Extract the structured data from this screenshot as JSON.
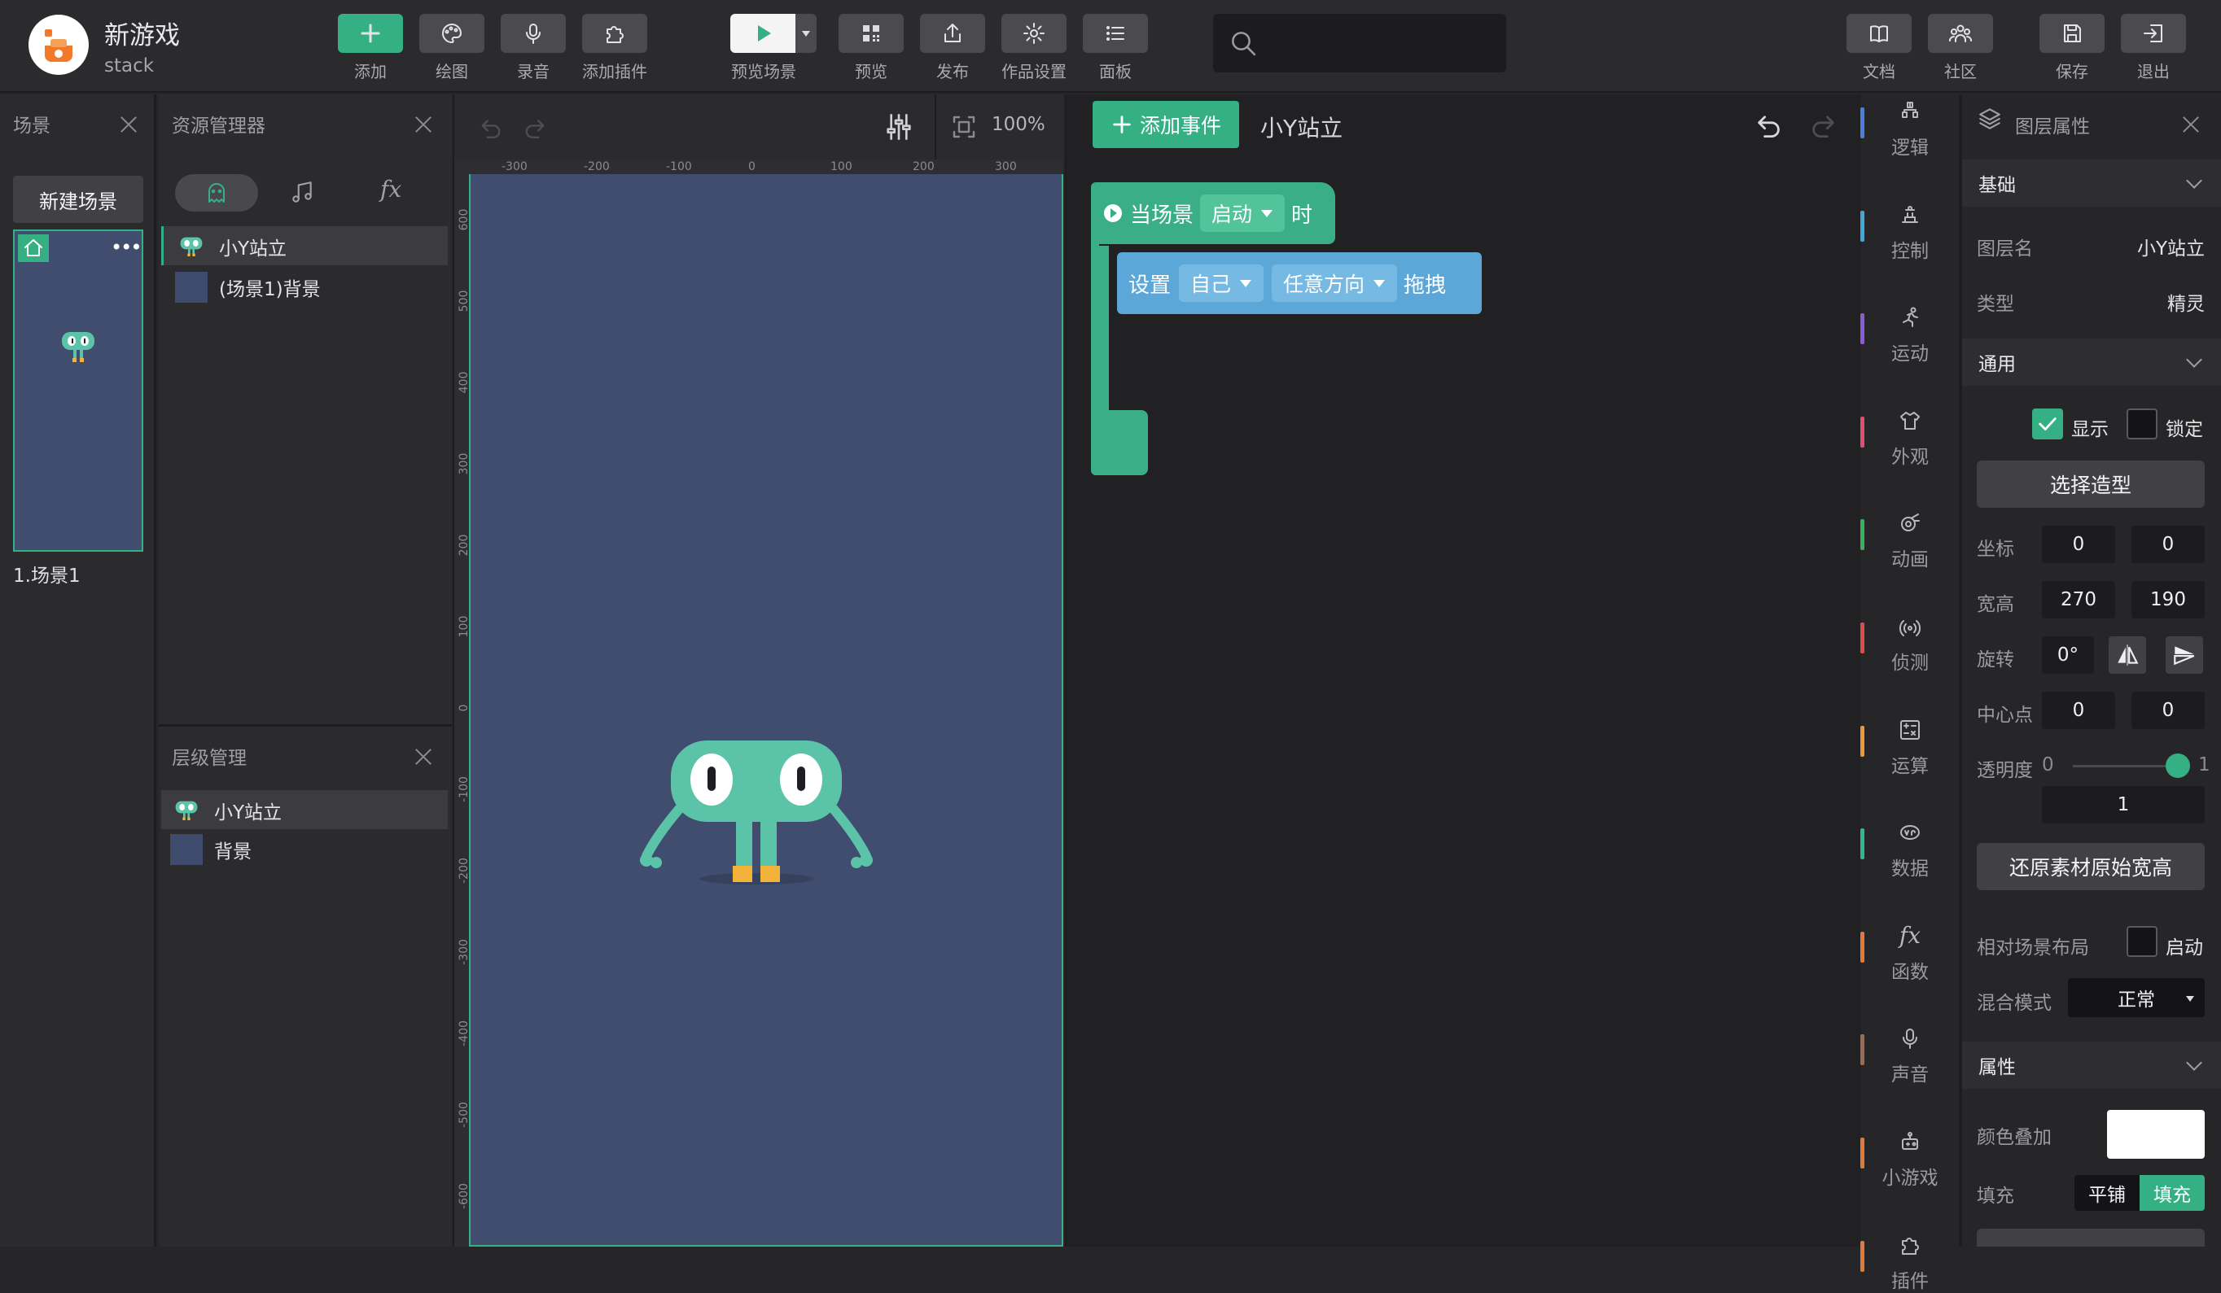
{
  "app": {
    "title": "新游戏",
    "user": "stack"
  },
  "toolbar": {
    "add": "添加",
    "paint": "绘图",
    "record": "录音",
    "plugin": "添加插件",
    "preview_scene": "预览场景",
    "preview": "预览",
    "publish": "发布",
    "settings": "作品设置",
    "panel": "面板",
    "docs": "文档",
    "community": "社区",
    "save": "保存",
    "exit": "退出"
  },
  "scenes_panel": {
    "title": "场景",
    "new_scene": "新建场景",
    "scene_label": "1.场景1",
    "more": "•••"
  },
  "assets_panel": {
    "title": "资源管理器",
    "fx_tab": "fx",
    "items": [
      {
        "label": "小Y站立"
      },
      {
        "label": "(场景1)背景"
      }
    ]
  },
  "layers_panel": {
    "title": "层级管理",
    "items": [
      {
        "label": "小Y站立"
      },
      {
        "label": "背景"
      }
    ]
  },
  "canvas": {
    "zoom": "100%",
    "ruler_x": [
      "-300",
      "-200",
      "-100",
      "0",
      "100",
      "200",
      "300"
    ],
    "ruler_y": [
      "600",
      "500",
      "400",
      "300",
      "200",
      "100",
      "0",
      "-100",
      "-200",
      "-300",
      "-400",
      "-500",
      "-600"
    ]
  },
  "code_area": {
    "add_event": "添加事件",
    "sprite_name": "小Y站立",
    "event_block": {
      "prefix": "当场景",
      "dropdown": "启动",
      "suffix": "时"
    },
    "action_block": {
      "prefix": "设置",
      "target": "自己",
      "direction": "任意方向",
      "action": "拖拽"
    }
  },
  "categories": [
    {
      "label": "逻辑",
      "icon": "logic-icon",
      "color": "#4a7fe0"
    },
    {
      "label": "控制",
      "icon": "control-icon",
      "color": "#3fa9de"
    },
    {
      "label": "运动",
      "icon": "motion-icon",
      "color": "#8b5bd6"
    },
    {
      "label": "外观",
      "icon": "looks-icon",
      "color": "#e0506e"
    },
    {
      "label": "动画",
      "icon": "animation-icon",
      "color": "#3dae5f"
    },
    {
      "label": "侦测",
      "icon": "sensing-icon",
      "color": "#e04a4a"
    },
    {
      "label": "运算",
      "icon": "operator-icon",
      "color": "#e79a3a"
    },
    {
      "label": "数据",
      "icon": "data-icon",
      "color": "#2fb88f"
    },
    {
      "label": "函数",
      "icon": "function-icon",
      "color": "#e07a3a"
    },
    {
      "label": "声音",
      "icon": "sound-icon",
      "color": "#9a6a55"
    },
    {
      "label": "小游戏",
      "icon": "minigame-icon",
      "color": "#e07a3a"
    },
    {
      "label": "插件",
      "icon": "plugin-icon",
      "color": "#e07a3a"
    }
  ],
  "properties": {
    "title": "图层属性",
    "basic": "基础",
    "layer_name_label": "图层名",
    "layer_name": "小Y站立",
    "type_label": "类型",
    "type": "精灵",
    "general": "通用",
    "visible": "显示",
    "lock": "锁定",
    "choose_costume": "选择造型",
    "coords_label": "坐标",
    "x": "0",
    "y": "0",
    "size_label": "宽高",
    "width": "270",
    "height": "190",
    "rotation_label": "旋转",
    "rotation": "0°",
    "pivot_label": "中心点",
    "pivot_x": "0",
    "pivot_y": "0",
    "opacity_label": "透明度",
    "opacity_min": "0",
    "opacity_max": "1",
    "opacity_value": "1",
    "restore_size": "还原素材原始宽高",
    "relative_layout_label": "相对场景布局",
    "relative_layout_toggle": "启动",
    "blend_label": "混合模式",
    "blend_value": "正常",
    "attributes": "属性",
    "color_overlay_label": "颜色叠加",
    "fill_label": "填充",
    "fill_tile": "平铺",
    "fill_fill": "填充"
  },
  "colors": {
    "accent": "#35b085",
    "block_event": "#3aaf87",
    "block_action": "#5ba8d8",
    "stage_bg": "#404d6e"
  }
}
